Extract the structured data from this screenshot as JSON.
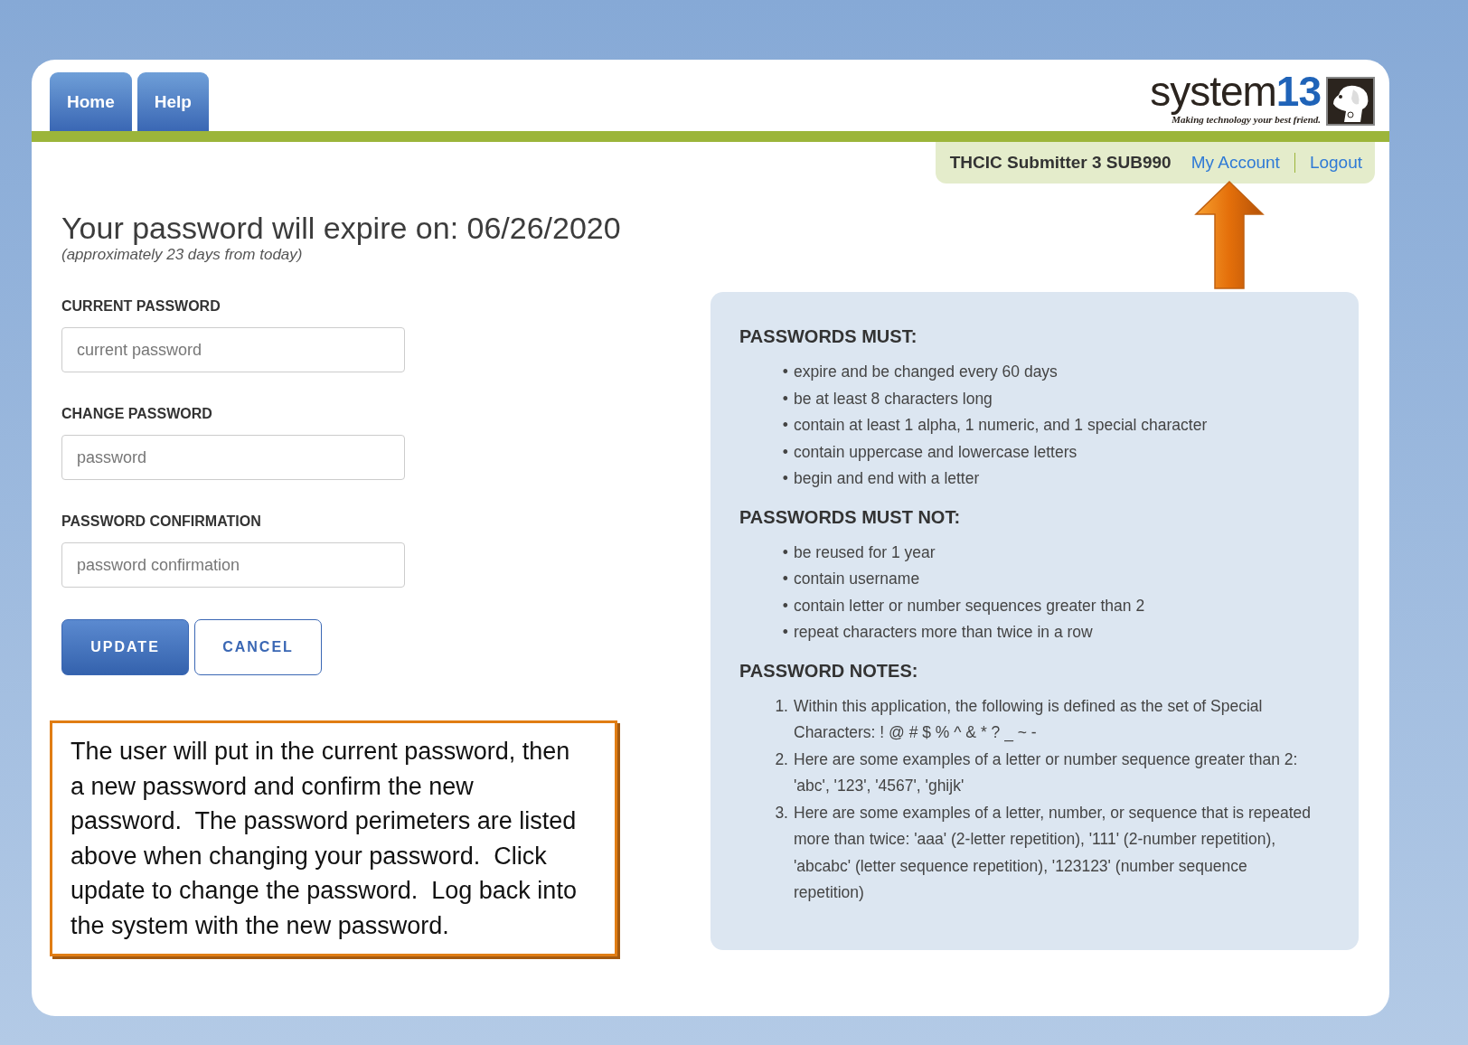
{
  "nav": {
    "tabs": [
      "Home",
      "Help"
    ]
  },
  "logo": {
    "word": "system",
    "number": "13",
    "tagline": "Making technology your best friend."
  },
  "user_bar": {
    "user": "THCIC Submitter 3 SUB990",
    "links": [
      "My Account",
      "Logout"
    ]
  },
  "heading": "Your password will expire on: 06/26/2020",
  "subheading": "(approximately 23 days from today)",
  "fields": [
    {
      "label": "CURRENT PASSWORD",
      "placeholder": "current password"
    },
    {
      "label": "CHANGE PASSWORD",
      "placeholder": "password"
    },
    {
      "label": "PASSWORD CONFIRMATION",
      "placeholder": "password confirmation"
    }
  ],
  "buttons": [
    {
      "label": "UPDATE",
      "kind": "primary"
    },
    {
      "label": "CANCEL",
      "kind": "secondary"
    }
  ],
  "annotation": "The user will put in the current password, then a new password and confirm the new password.  The password perimeters are listed above when changing your password.  Click update to change the password.  Log back into the system with the new password.",
  "rules": [
    {
      "heading": "PASSWORDS MUST:",
      "items": [
        {
          "marker": "•",
          "text": "expire and be changed every 60 days"
        },
        {
          "marker": "•",
          "text": "be at least 8 characters long"
        },
        {
          "marker": "•",
          "text": "contain at least 1 alpha, 1 numeric, and 1 special character"
        },
        {
          "marker": "•",
          "text": "contain uppercase and lowercase letters"
        },
        {
          "marker": "•",
          "text": "begin and end with a letter"
        }
      ]
    },
    {
      "heading": "PASSWORDS MUST NOT:",
      "items": [
        {
          "marker": "•",
          "text": "be reused for 1 year"
        },
        {
          "marker": "•",
          "text": "contain username"
        },
        {
          "marker": "•",
          "text": "contain letter or number sequences greater than 2"
        },
        {
          "marker": "•",
          "text": "repeat characters more than twice in a row"
        }
      ]
    },
    {
      "heading": "PASSWORD NOTES:",
      "items": [
        {
          "marker": "1.",
          "text": "Within this application, the following is defined as the set of Special Characters: ! @ # $ % ^ & * ? _ ~ -"
        },
        {
          "marker": "2.",
          "text": "Here are some examples of a letter or number sequence greater than 2: 'abc', '123', '4567', 'ghijk'"
        },
        {
          "marker": "3.",
          "text": "Here are some examples of a letter, number, or sequence that is repeated more than twice: 'aaa' (2-letter repetition), '111' (2-number repetition), 'abcabc' (letter sequence repetition), '123123' (number sequence repetition)"
        }
      ]
    }
  ]
}
